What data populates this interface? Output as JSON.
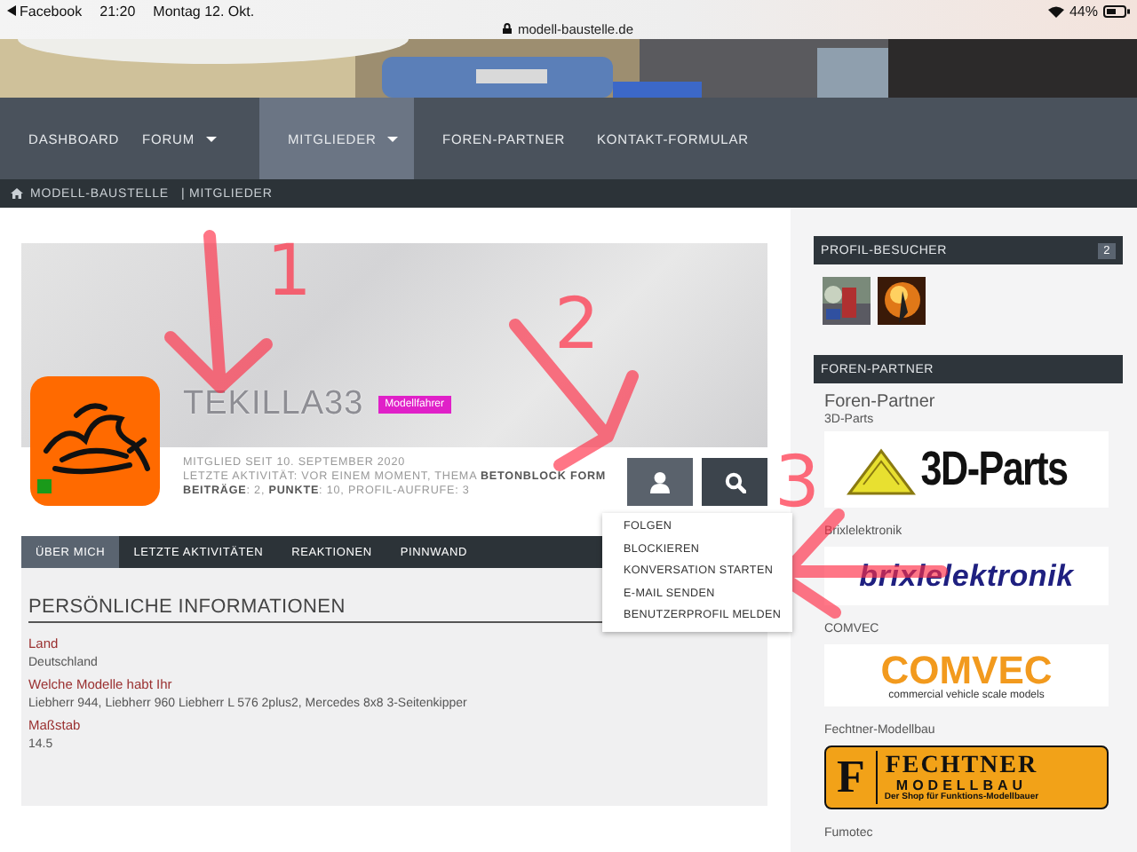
{
  "status_bar": {
    "back_app": "Facebook",
    "time": "21:20",
    "date": "Montag 12. Okt.",
    "url": "modell-baustelle.de",
    "battery": "44%"
  },
  "banner": {
    "kind": "picture"
  },
  "nav": [
    {
      "label": "DASHBOARD",
      "selected": false,
      "dropdown": false
    },
    {
      "label": "FORUM",
      "selected": false,
      "dropdown": true
    },
    {
      "label": "MITGLIEDER",
      "selected": true,
      "dropdown": true
    },
    {
      "label": "FOREN-PARTNER",
      "selected": false,
      "dropdown": false
    },
    {
      "label": "KONTAKT-FORMULAR",
      "selected": false,
      "dropdown": false
    }
  ],
  "breadcrumb": [
    "MODELL-BAUSTELLE",
    "| MITGLIEDER"
  ],
  "profile": {
    "username": "TEKILLA33",
    "badge": "Modellfahrer",
    "online": true,
    "info_lines": [
      "MITGLIED SEIT 10. SEPTEMBER 2020",
      "LETZTE AKTIVITÄT: VOR EINEM MOMENT, THEMA **BETONBLOCK FORM**",
      "**BEITRÄGE**: 2, **PUNKTE**: 10, PROFIL-AUFRUFE: 3"
    ]
  },
  "menu": [
    "FOLGEN",
    "BLOCKIEREN",
    "KONVERSATION STARTEN",
    "E-MAIL SENDEN",
    "BENUTZERPROFIL MELDEN"
  ],
  "tabs": [
    {
      "label": "ÜBER MICH",
      "selected": true
    },
    {
      "label": "LETZTE AKTIVITÄTEN",
      "selected": false
    },
    {
      "label": "REAKTIONEN",
      "selected": false
    },
    {
      "label": "PINNWAND",
      "selected": false
    }
  ],
  "about": {
    "heading": "PERSÖNLICHE INFORMATIONEN",
    "fields": [
      {
        "label": "Land",
        "value": "Deutschland"
      },
      {
        "label": "Welche Modelle habt Ihr",
        "value": "Liebherr 944, Liebherr 960 Liebherr L 576 2plus2, Mercedes 8x8 3-Seitenkipper"
      },
      {
        "label": "Maßstab",
        "value": "14.5"
      }
    ]
  },
  "visitors": {
    "title": "PROFIL-BESUCHER",
    "count": "2",
    "avatars": [
      {
        "kind": "picture"
      },
      {
        "kind": "picture"
      }
    ]
  },
  "partners": {
    "title": "FOREN-PARTNER",
    "heading": "Foren-Partner",
    "items": [
      {
        "name": "3D-Parts",
        "kind": "threedparts",
        "logo": [
          "3D-Parts"
        ]
      },
      {
        "name": "Brixlelektronik",
        "kind": "brixl",
        "logo": [
          "brixlelektronik"
        ]
      },
      {
        "name": "COMVEC",
        "kind": "comvec",
        "logo": [
          "COMVEC",
          "commercial vehicle scale models"
        ]
      },
      {
        "name": "Fechtner-Modellbau",
        "kind": "fechtner",
        "logo": [
          "F",
          "FECHTNER",
          "MODELLBAU",
          "Der Shop für Funktions-Modellbauer"
        ]
      },
      {
        "name": "Fumotec",
        "kind": "none"
      }
    ]
  },
  "annotations": [
    {
      "label": "1"
    },
    {
      "label": "2"
    },
    {
      "label": "3"
    }
  ]
}
